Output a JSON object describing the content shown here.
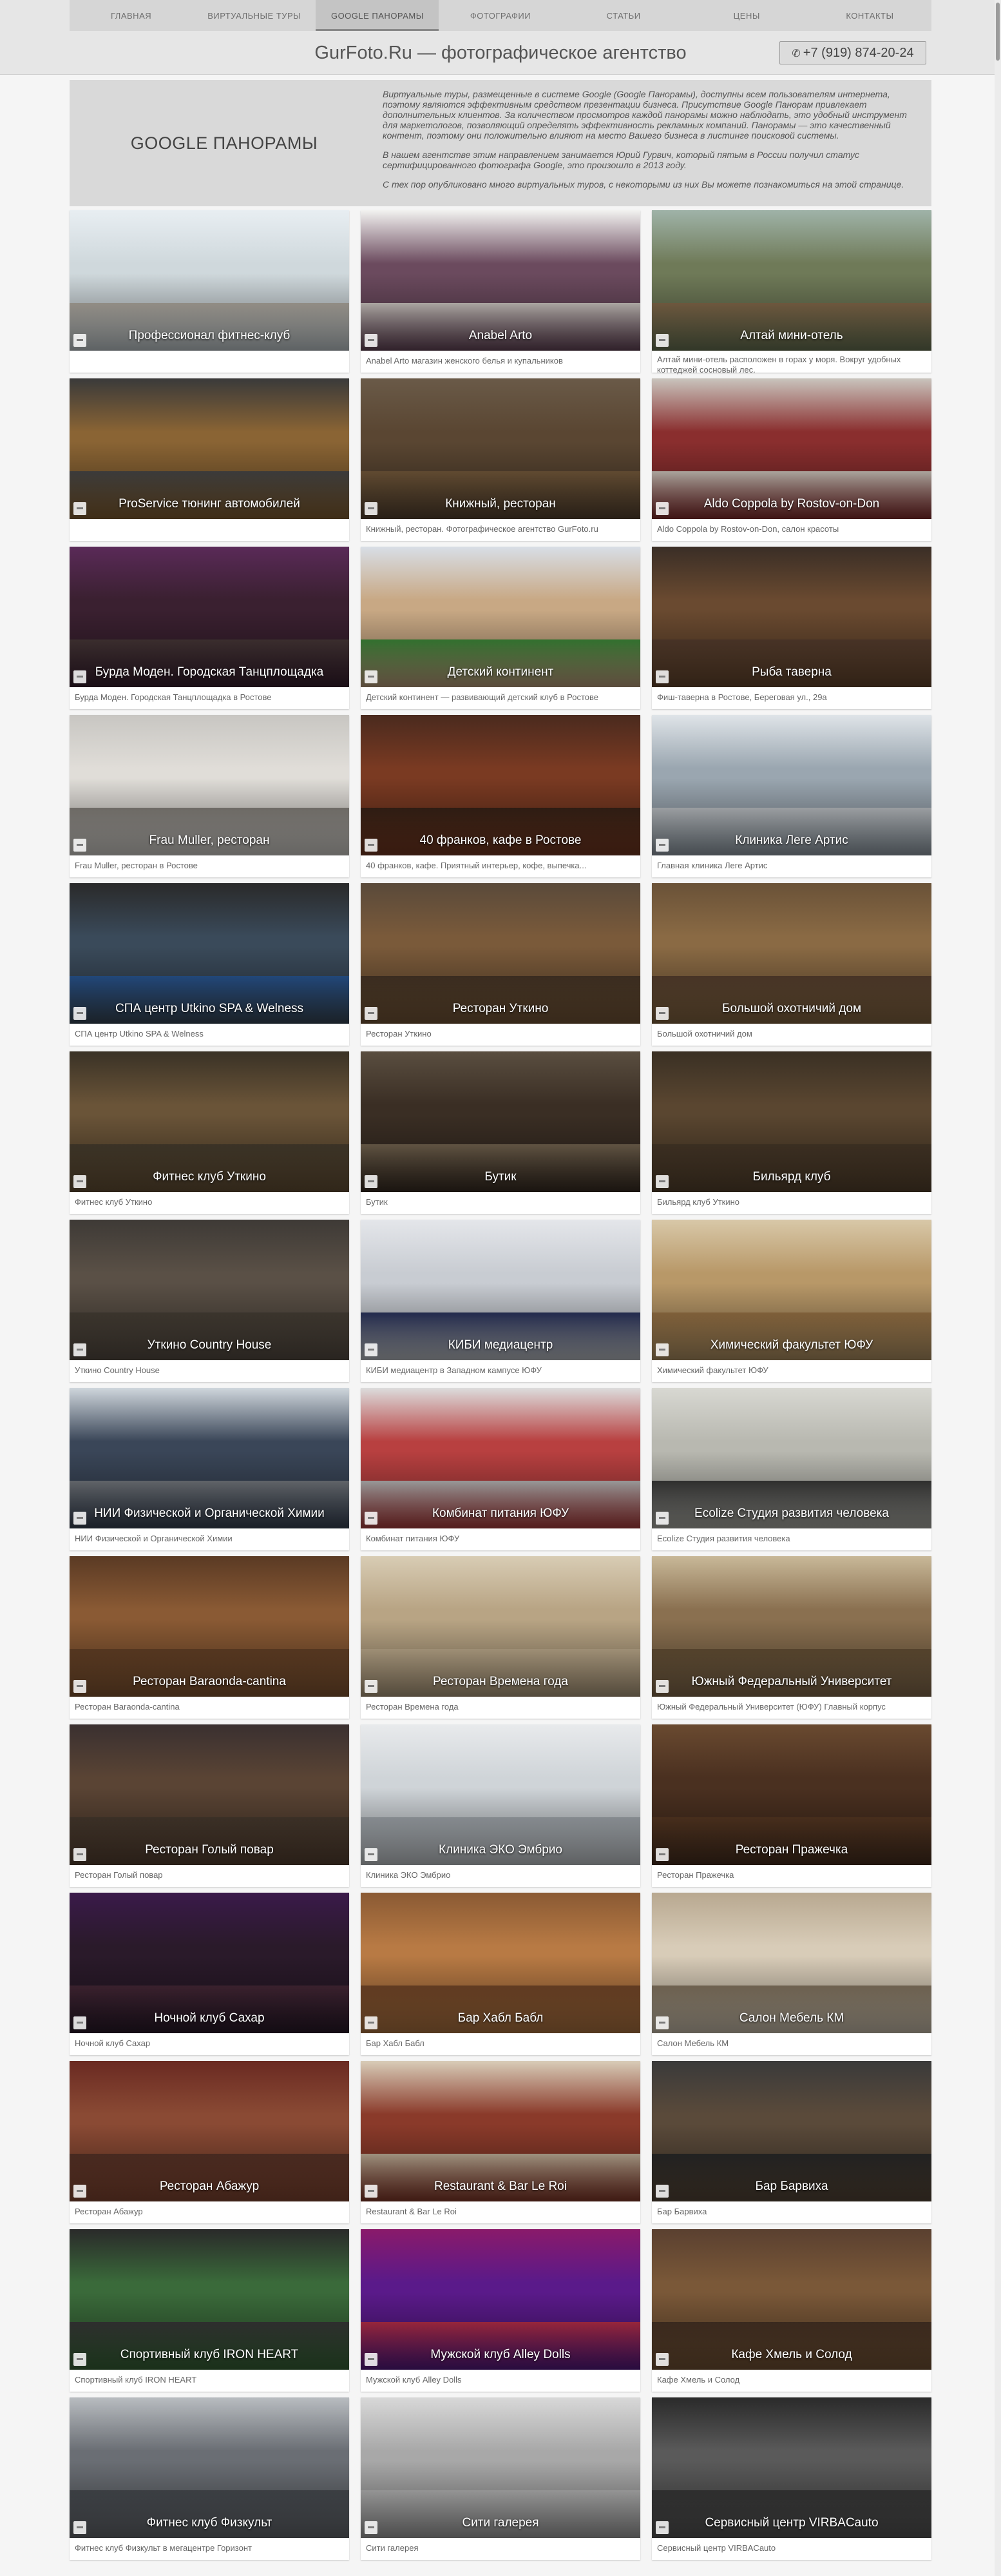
{
  "nav": {
    "items": [
      "ГЛАВНАЯ",
      "ВИРТУАЛЬНЫЕ ТУРЫ",
      "GOOGLE ПАНОРАМЫ",
      "ФОТОГРАФИИ",
      "СТАТЬИ",
      "ЦЕНЫ",
      "КОНТАКТЫ"
    ],
    "active": "GOOGLE ПАНОРАМЫ"
  },
  "header": {
    "title": "GurFoto.Ru — фотографическое агентство",
    "phone": "+7 (919) 874-20-24"
  },
  "intro": {
    "heading": "GOOGLE ПАНОРАМЫ",
    "paragraphs": [
      "Виртуальные туры, размещенные в системе Google (Google Панорамы), доступны всем пользователям интернета, поэтому являются эффективным средством презентации бизнеса. Присутствие Google Панорам привлекает дополнительных клиентов. За количеством просмотров каждой панорамы можно наблюдать, это удобный инструмент для маркетологов, позволяющий определять эффективность рекламных компаний. Панорамы — это качественный контент, поэтому они положительно влияют на место Вашего бизнеса в листинге поисковой системы.",
      "В нашем агентстве этим направлением занимается Юрий Гурвич, который пятым в России получил статус сертифицированного фотографа Google, это произошло в 2013 году.",
      "С тех пор опубликовано много виртуальных туров, с некоторыми из них Вы можете познакомиться на этой странице."
    ]
  },
  "cards": [
    {
      "title": "Профессионал фитнес-клуб",
      "caption": "",
      "palette": [
        "#e8eef2",
        "#cfd8dc",
        "#b8b2a8"
      ]
    },
    {
      "title": "Anabel Arto",
      "caption": "Anabel Arto магазин женского белья и купальников",
      "palette": [
        "#f2f2f0",
        "#6b4a5e",
        "#d8d2cc"
      ]
    },
    {
      "title": "Алтай мини-отель",
      "caption": "Алтай мини-отель расположен в горах у моря. Вокруг удобных коттеджей сосновый лес.",
      "palette": [
        "#9fb3a8",
        "#6f7a58",
        "#8a6e4e"
      ]
    },
    {
      "title": "ProService тюнинг автомобилей",
      "caption": "",
      "palette": [
        "#3a3a3a",
        "#8a6434",
        "#4a4a4a"
      ]
    },
    {
      "title": "Книжный, ресторан",
      "caption": "Книжный, ресторан. Фотографическое агентство GurFoto.ru",
      "palette": [
        "#6a5a48",
        "#5a4632",
        "#7a5e3e"
      ]
    },
    {
      "title": "Aldo Coppola by Rostov-on-Don",
      "caption": "Aldo Coppola by Rostov-on-Don, салон красоты",
      "palette": [
        "#c9c4bd",
        "#8a2e2e",
        "#d8d0c6"
      ]
    },
    {
      "title": "Бурда Моден. Городская Танцплощадка",
      "caption": "Бурда Моден. Городская Танцплощадка в Ростове",
      "palette": [
        "#5a2a58",
        "#3a2030",
        "#4a3a3a"
      ]
    },
    {
      "title": "Детский континент",
      "caption": "Детский континент — развивающий детский клуб в Ростове",
      "palette": [
        "#d8dee6",
        "#c8a884",
        "#3e8e3a"
      ]
    },
    {
      "title": "Рыба таверна",
      "caption": "Фиш-таверна в Ростове, Береговая ул., 29а",
      "palette": [
        "#3a2e26",
        "#6a4a30",
        "#5a4030"
      ]
    },
    {
      "title": "Frau Muller, ресторан",
      "caption": "Frau Muller, ресторан в Ростове",
      "palette": [
        "#c8c6c2",
        "#e0ddd8",
        "#8a8680"
      ]
    },
    {
      "title": "40 франков, кафе в Ростове",
      "caption": "40 франков, кафе. Приятный интерьер, кофе, выпечка...",
      "palette": [
        "#4a2a1e",
        "#7a3a22",
        "#3a2418"
      ]
    },
    {
      "title": "Клиника Леге Артис",
      "caption": "Главная клиника Леге Артис",
      "palette": [
        "#dfe4e8",
        "#9aa6b0",
        "#c4c8cc"
      ]
    },
    {
      "title": "СПА центр Utkino SPA & Welness",
      "caption": "СПА центр Utkino SPA & Welness",
      "palette": [
        "#2a2a2a",
        "#3a4a5a",
        "#2a5a9a"
      ]
    },
    {
      "title": "Ресторан Уткино",
      "caption": "Ресторан Уткино",
      "palette": [
        "#5a4a3a",
        "#7a5a3a",
        "#4a3828"
      ]
    },
    {
      "title": "Большой охотничий дом",
      "caption": "Большой охотничий дом",
      "palette": [
        "#6a5238",
        "#8a6a44",
        "#5a4230"
      ]
    },
    {
      "title": "Фитнес клуб Уткино",
      "caption": "Фитнес клуб Уткино",
      "palette": [
        "#3a3226",
        "#6a5438",
        "#4a4030"
      ]
    },
    {
      "title": "Бутик",
      "caption": "Бутик",
      "palette": [
        "#5a4e40",
        "#3a2e24",
        "#7a6a54"
      ]
    },
    {
      "title": "Бильярд клуб",
      "caption": "Бильярд клуб Уткино",
      "palette": [
        "#3a3024",
        "#5a4630",
        "#4a3a2a"
      ]
    },
    {
      "title": "Уткино Country House",
      "caption": "Уткино Country House",
      "palette": [
        "#3e3a36",
        "#5a5046",
        "#4a4238"
      ]
    },
    {
      "title": "КИБИ медиацентр",
      "caption": "КИБИ медиацентр в Западном кампусе ЮФУ",
      "palette": [
        "#e4e6ea",
        "#c8ccd2",
        "#2a3460"
      ]
    },
    {
      "title": "Химический факультет ЮФУ",
      "caption": "Химический факультет ЮФУ",
      "palette": [
        "#d8c8a8",
        "#b89868",
        "#a07848"
      ]
    },
    {
      "title": "НИИ Физической и Органической Химии",
      "caption": "НИИ Физической и Органической Химии",
      "palette": [
        "#cfd6dc",
        "#3a4658",
        "#7a7e84"
      ]
    },
    {
      "title": "Комбинат питания ЮФУ",
      "caption": "Комбинат питания ЮФУ",
      "palette": [
        "#dcdcdc",
        "#b84040",
        "#c0c0c0"
      ]
    },
    {
      "title": "Ecolize Студия развития человека",
      "caption": "Ecolize Студия развития человека",
      "palette": [
        "#d8d8d2",
        "#b8b8b0",
        "#3a3a3a"
      ]
    },
    {
      "title": "Ресторан Baraonda-cantina",
      "caption": "Ресторан Baraonda-cantina",
      "palette": [
        "#5a3a24",
        "#8a5a34",
        "#6a4428"
      ]
    },
    {
      "title": "Ресторан Времена года",
      "caption": "Ресторан Времена года",
      "palette": [
        "#d8ccb4",
        "#b8a484",
        "#c8b494"
      ]
    },
    {
      "title": "Южный Федеральный Университет",
      "caption": "Южный Федеральный Университет (ЮФУ) Главный корпус",
      "palette": [
        "#c8b898",
        "#8a7050",
        "#6a5438"
      ]
    },
    {
      "title": "Ресторан Голый повар",
      "caption": "Ресторан Голый повар",
      "palette": [
        "#3a3030",
        "#5a4434",
        "#4a3c30"
      ]
    },
    {
      "title": "Клиника ЭКО Эмбрио",
      "caption": "Клиника ЭКО Эмбрио",
      "palette": [
        "#e8eaec",
        "#cfd4d8",
        "#a8aeb4"
      ]
    },
    {
      "title": "Ресторан Пражечка",
      "caption": "Ресторан Пражечка",
      "palette": [
        "#6a4a30",
        "#4a3020",
        "#5a3a24"
      ]
    },
    {
      "title": "Ночной клуб Сахар",
      "caption": "Ночной клуб Сахар",
      "palette": [
        "#3a1a4a",
        "#2a1a2a",
        "#4a2a3a"
      ]
    },
    {
      "title": "Бар Хабл Бабл",
      "caption": "Бар Хабл Бабл",
      "palette": [
        "#8a5a34",
        "#b87a44",
        "#7a4a2a"
      ]
    },
    {
      "title": "Салон Мебель КМ",
      "caption": "Салон Мебель КМ",
      "palette": [
        "#b8a890",
        "#d8ccb8",
        "#8a7a64"
      ]
    },
    {
      "title": "Ресторан Абажур",
      "caption": "Ресторан Абажур",
      "palette": [
        "#6a2a22",
        "#8a4a34",
        "#5a3428"
      ]
    },
    {
      "title": "Restaurant & Bar Le Roi",
      "caption": "Restaurant & Bar Le Roi",
      "palette": [
        "#d8ccb8",
        "#8a3a2a",
        "#c8b8a0"
      ]
    },
    {
      "title": "Бар Барвиха",
      "caption": "Бар Барвиха",
      "palette": [
        "#3a3a3a",
        "#5a4a3a",
        "#2a2a2a"
      ]
    },
    {
      "title": "Спортивный клуб IRON HEART",
      "caption": "Спортивный клуб IRON HEART",
      "palette": [
        "#2a2a2a",
        "#3a6a3a",
        "#3a3a3a"
      ]
    },
    {
      "title": "Мужской клуб Alley Dolls",
      "caption": "Мужской клуб Alley Dolls",
      "palette": [
        "#8a1a6a",
        "#5a1a8a",
        "#c0304a"
      ]
    },
    {
      "title": "Кафе Хмель и Солод",
      "caption": "Кафе Хмель и Солод",
      "palette": [
        "#5a4030",
        "#7a5838",
        "#4a3426"
      ]
    },
    {
      "title": "Фитнес клуб Физкульт",
      "caption": "Фитнес клуб Физкульт в мегацентре Горизонт",
      "palette": [
        "#b8bcc0",
        "#6a6e74",
        "#4a4e54"
      ]
    },
    {
      "title": "Сити галерея",
      "caption": "Сити галерея",
      "palette": [
        "#d8d8d8",
        "#a8a8a8",
        "#bcbcbc"
      ]
    },
    {
      "title": "Сервисный центр VIRBACauto",
      "caption": "Сервисный центр VIRBACauto",
      "palette": [
        "#2a2a2a",
        "#5a5a5a",
        "#3a3a3a"
      ]
    }
  ]
}
